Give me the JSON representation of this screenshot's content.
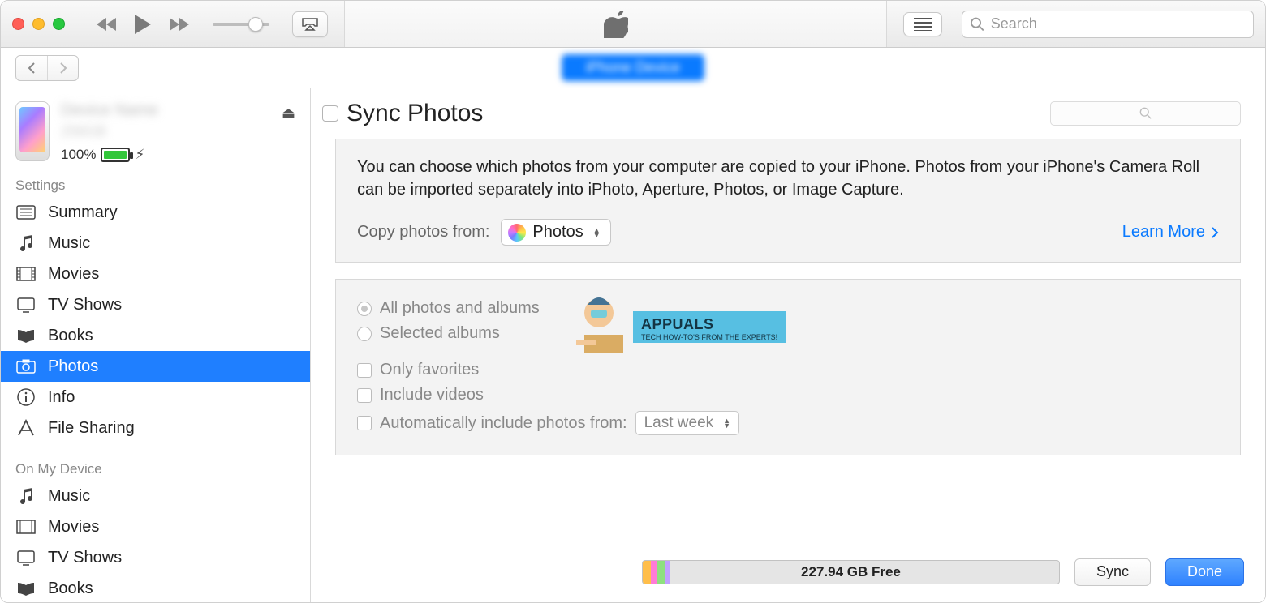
{
  "titlebar": {
    "search_placeholder": "Search"
  },
  "device": {
    "battery_pct": "100%"
  },
  "sidebar": {
    "settings_heading": "Settings",
    "settings": [
      {
        "label": "Summary"
      },
      {
        "label": "Music"
      },
      {
        "label": "Movies"
      },
      {
        "label": "TV Shows"
      },
      {
        "label": "Books"
      },
      {
        "label": "Photos"
      },
      {
        "label": "Info"
      },
      {
        "label": "File Sharing"
      }
    ],
    "device_heading": "On My Device",
    "on_device": [
      {
        "label": "Music"
      },
      {
        "label": "Movies"
      },
      {
        "label": "TV Shows"
      },
      {
        "label": "Books"
      }
    ]
  },
  "main": {
    "sync_title": "Sync Photos",
    "info_text": "You can choose which photos from your computer are copied to your iPhone. Photos from your iPhone's Camera Roll can be imported separately into iPhoto, Aperture, Photos, or Image Capture.",
    "copy_label": "Copy photos from:",
    "copy_source": "Photos",
    "learn_more": "Learn More",
    "opts": {
      "all": "All photos and albums",
      "selected": "Selected albums",
      "favorites": "Only favorites",
      "videos": "Include videos",
      "auto": "Automatically include photos from:",
      "auto_range": "Last week"
    }
  },
  "footer": {
    "free_space": "227.94 GB Free",
    "sync_btn": "Sync",
    "done_btn": "Done"
  },
  "watermark": {
    "brand": "APPUALS",
    "tag": "TECH HOW-TO'S FROM THE EXPERTS!"
  }
}
